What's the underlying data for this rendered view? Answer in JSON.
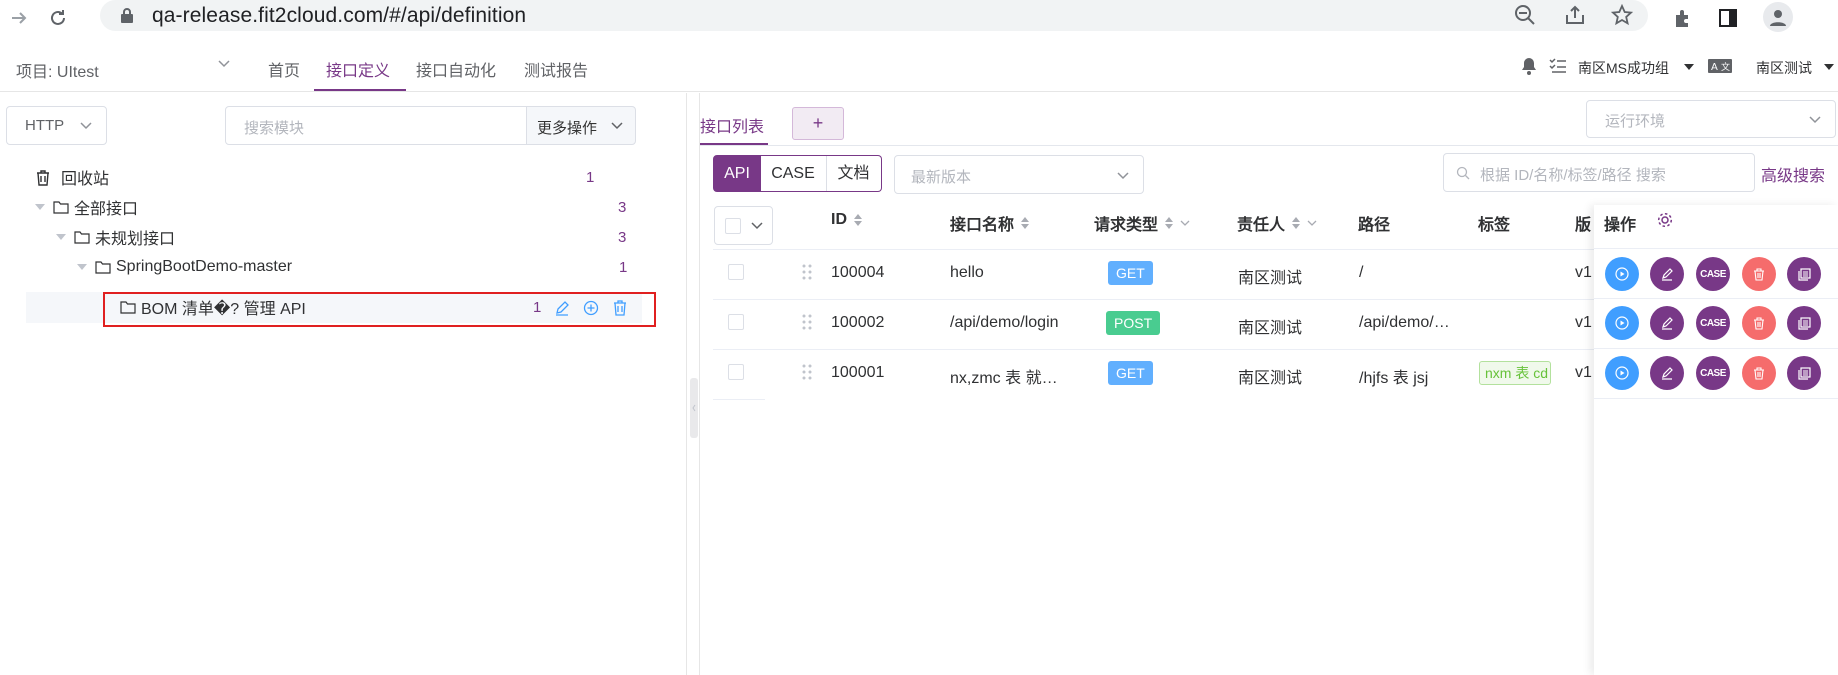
{
  "browser": {
    "url": "qa-release.fit2cloud.com/#/api/definition"
  },
  "header": {
    "project": "项目: UItest",
    "nav": [
      "首页",
      "接口定义",
      "接口自动化",
      "测试报告"
    ],
    "workspace": "南区MS成功组",
    "user": "南区测试"
  },
  "left": {
    "protocol": "HTTP",
    "search_placeholder": "搜索模块",
    "more_ops": "更多操作",
    "tree": [
      {
        "label": "回收站",
        "count": "1"
      },
      {
        "label": "全部接口",
        "count": "3"
      },
      {
        "label": "未规划接口",
        "count": "3"
      },
      {
        "label": "SpringBootDemo-master",
        "count": "1"
      },
      {
        "label": "BOM 清单�? 管理 API",
        "count": "1"
      }
    ]
  },
  "right": {
    "tab": "接口列表",
    "tab_add": "+",
    "env_placeholder": "运行环境",
    "segments": [
      "API",
      "CASE",
      "文档"
    ],
    "version_placeholder": "最新版本",
    "search_placeholder": "根据 ID/名称/标签/路径 搜索",
    "advanced_search": "高级搜索",
    "columns": [
      "ID",
      "接口名称",
      "请求类型",
      "责任人",
      "路径",
      "标签",
      "版",
      "操作"
    ],
    "rows": [
      {
        "id": "100004",
        "name": "hello",
        "method": "GET",
        "owner": "南区测试",
        "path": "/",
        "tag": "",
        "version": "v1"
      },
      {
        "id": "100002",
        "name": "/api/demo/login",
        "method": "POST",
        "owner": "南区测试",
        "path": "/api/demo/…",
        "tag": "",
        "version": "v1"
      },
      {
        "id": "100001",
        "name": "nx,zmc 表 就…",
        "method": "GET",
        "owner": "南区测试",
        "path": "/hjfs 表 jsj",
        "tag": "nxm 表 cd",
        "version": "v1"
      }
    ],
    "op_case_label": "CASE"
  },
  "colors": {
    "primary": "#783887",
    "get": "#61affe",
    "post": "#49cc90",
    "delete": "#f56c6c",
    "run": "#409eff"
  }
}
